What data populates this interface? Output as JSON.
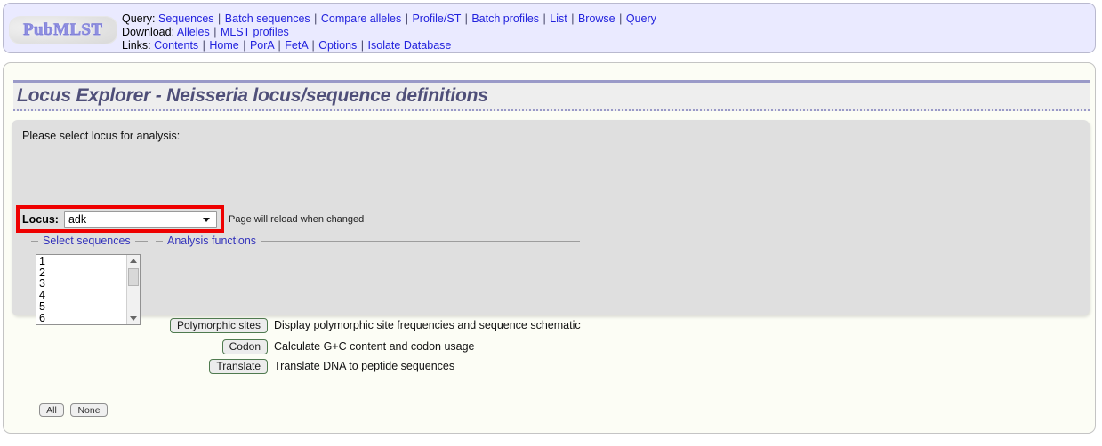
{
  "header": {
    "logo_text": "PubMLST",
    "nav_rows": [
      {
        "label": "Query:",
        "links": [
          "Sequences",
          "Batch sequences",
          "Compare alleles",
          "Profile/ST",
          "Batch profiles",
          "List",
          "Browse",
          "Query"
        ]
      },
      {
        "label": "Download:",
        "links": [
          "Alleles",
          "MLST profiles"
        ]
      },
      {
        "label": "Links:",
        "links": [
          "Contents",
          "Home",
          "PorA",
          "FetA",
          "Options",
          "Isolate Database"
        ]
      }
    ],
    "separator": "|"
  },
  "page": {
    "title": "Locus Explorer - Neisseria locus/sequence definitions"
  },
  "form": {
    "instruction": "Please select locus for analysis:",
    "locus_label": "Locus:",
    "locus_value": "adk",
    "locus_options": [
      "adk"
    ],
    "reload_note": "Page will reload when changed"
  },
  "select_sequences": {
    "legend": "Select sequences",
    "items": [
      "1",
      "2",
      "3",
      "4",
      "5",
      "6"
    ],
    "all_label": "All",
    "none_label": "None"
  },
  "analysis_functions": {
    "legend": "Analysis functions",
    "functions": [
      {
        "button": "Polymorphic sites",
        "description": "Display polymorphic site frequencies and sequence schematic"
      },
      {
        "button": "Codon",
        "description": "Calculate G+C content and codon usage"
      },
      {
        "button": "Translate",
        "description": "Translate DNA to peptide sequences"
      }
    ]
  },
  "colors": {
    "header_bg": "#eaeaff",
    "content_bg": "#fcfdf5",
    "panel_bg": "#dfdfdf",
    "link": "#2222dd",
    "title": "#4f4f79",
    "legend": "#3333bb",
    "annotation": "#ee0000"
  }
}
